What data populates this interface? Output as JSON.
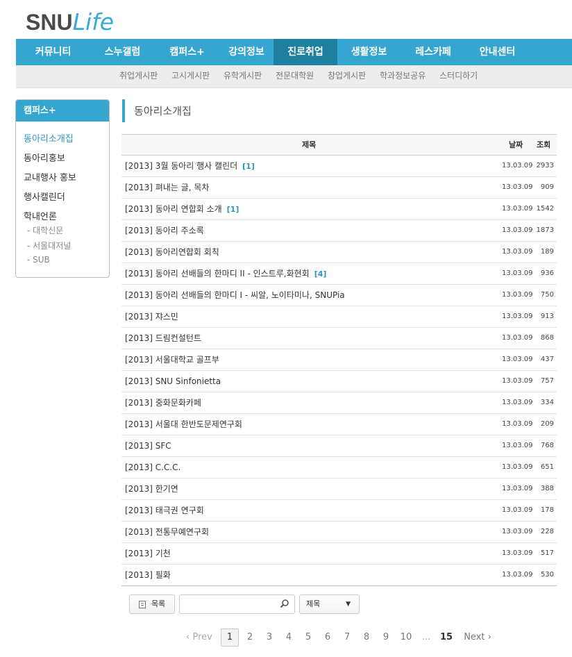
{
  "logo": {
    "snu": "SNU",
    "life": "Life"
  },
  "gnb": [
    "커뮤니티",
    "스누갤럼",
    "캠퍼스+",
    "강의정보",
    "진로취업",
    "생활정보",
    "레스카페",
    "안내센터"
  ],
  "subnav": [
    "취업게시판",
    "고시게시판",
    "유학게시판",
    "전문대학원",
    "창업게시판",
    "학과정보공유",
    "스터디하기"
  ],
  "sidebar": {
    "title": "캠퍼스+",
    "items": [
      "동아리소개집",
      "동아리홍보",
      "교내행사 홍보",
      "행사캘린더",
      "학내언론"
    ],
    "subitems": [
      "- 대학신문",
      "- 서울대저널",
      "- SUB"
    ]
  },
  "page_title": "동아리소개집",
  "table": {
    "headers": {
      "subject": "제목",
      "date": "날짜",
      "views": "조회"
    },
    "rows": [
      {
        "subject": "[2013] 3월 동아리 행사 캘린더",
        "comments": "[1]",
        "date": "13.03.09",
        "views": "2933"
      },
      {
        "subject": "[2013] 펴내는 글, 목차",
        "comments": "",
        "date": "13.03.09",
        "views": "909"
      },
      {
        "subject": "[2013] 동아리 연합회 소개",
        "comments": "[1]",
        "date": "13.03.09",
        "views": "1542"
      },
      {
        "subject": "[2013] 동아리 주소록",
        "comments": "",
        "date": "13.03.09",
        "views": "1873"
      },
      {
        "subject": "[2013] 동아리연합회 회칙",
        "comments": "",
        "date": "13.03.09",
        "views": "189"
      },
      {
        "subject": "[2013] 동아리 선배들의 한마디 II - 인스트루,화현회",
        "comments": "[4]",
        "date": "13.03.09",
        "views": "936"
      },
      {
        "subject": "[2013] 동아리 선배들의 한마디 I - 씨알, 노이타미나, SNUPia",
        "comments": "",
        "date": "13.03.09",
        "views": "750"
      },
      {
        "subject": "[2013] 쟈스민",
        "comments": "",
        "date": "13.03.09",
        "views": "913"
      },
      {
        "subject": "[2013] 드림컨설턴트",
        "comments": "",
        "date": "13.03.09",
        "views": "868"
      },
      {
        "subject": "[2013] 서울대학교 골프부",
        "comments": "",
        "date": "13.03.09",
        "views": "437"
      },
      {
        "subject": "[2013] SNU Sinfonietta",
        "comments": "",
        "date": "13.03.09",
        "views": "757"
      },
      {
        "subject": "[2013] 중화문화카페",
        "comments": "",
        "date": "13.03.09",
        "views": "334"
      },
      {
        "subject": "[2013] 서울대 한반도문제연구회",
        "comments": "",
        "date": "13.03.09",
        "views": "209"
      },
      {
        "subject": "[2013] SFC",
        "comments": "",
        "date": "13.03.09",
        "views": "768"
      },
      {
        "subject": "[2013] C.C.C.",
        "comments": "",
        "date": "13.03.09",
        "views": "651"
      },
      {
        "subject": "[2013] 한기연",
        "comments": "",
        "date": "13.03.09",
        "views": "388"
      },
      {
        "subject": "[2013] 태극권 연구회",
        "comments": "",
        "date": "13.03.09",
        "views": "178"
      },
      {
        "subject": "[2013] 전통무예연구회",
        "comments": "",
        "date": "13.03.09",
        "views": "228"
      },
      {
        "subject": "[2013] 기천",
        "comments": "",
        "date": "13.03.09",
        "views": "517"
      },
      {
        "subject": "[2013] 필화",
        "comments": "",
        "date": "13.03.09",
        "views": "530"
      }
    ]
  },
  "controls": {
    "list_button": "목록",
    "search_value": "",
    "search_icon": "search-icon",
    "select_value": "제목",
    "select_arrow": "▼"
  },
  "pager": {
    "prev": "‹ Prev",
    "pages": [
      "1",
      "2",
      "3",
      "4",
      "5",
      "6",
      "7",
      "8",
      "9",
      "10"
    ],
    "ellipsis": "...",
    "last": "15",
    "next": "Next ›",
    "current": "1"
  },
  "colors": {
    "accent": "#35a6cf",
    "active_nav": "#1f7f9e",
    "link": "#2f96c4"
  }
}
